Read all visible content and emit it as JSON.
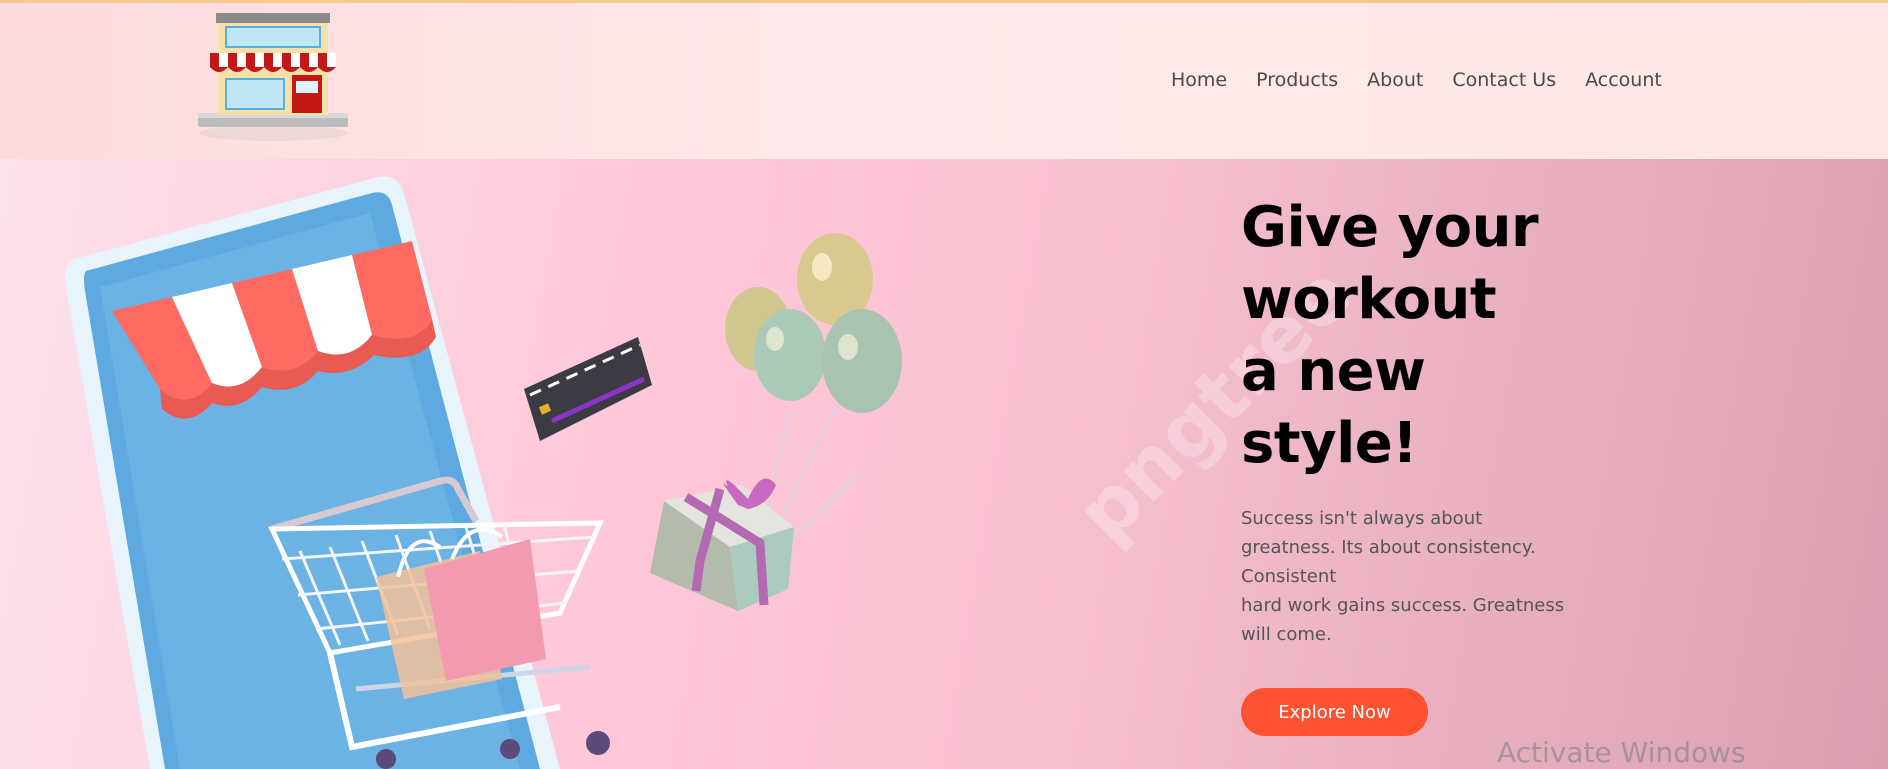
{
  "nav": {
    "items": [
      "Home",
      "Products",
      "About",
      "Contact Us",
      "Account"
    ]
  },
  "hero": {
    "heading_lines": [
      "Give your",
      "workout",
      "a new",
      "style!"
    ],
    "description_lines": [
      "Success isn't always about",
      "greatness. Its about consistency.",
      "Consistent",
      "hard work gains success. Greatness",
      "will come."
    ],
    "cta_label": "Explore Now",
    "watermark": "pngtree"
  },
  "os_overlay": {
    "activate_text": "Activate Windows"
  },
  "icons": {
    "logo": "storefront-icon",
    "phone": "smartphone-shop-illustration",
    "card": "credit-card-icon",
    "cart": "shopping-cart-icon",
    "balloons": "balloons-icon",
    "gift": "gift-box-icon"
  },
  "colors": {
    "accent": "#ff5233",
    "heading": "#000000",
    "nav_text": "#4a4a4a",
    "header_bg": "#ffe9ea",
    "hero_bg": "#ffc7d8"
  }
}
